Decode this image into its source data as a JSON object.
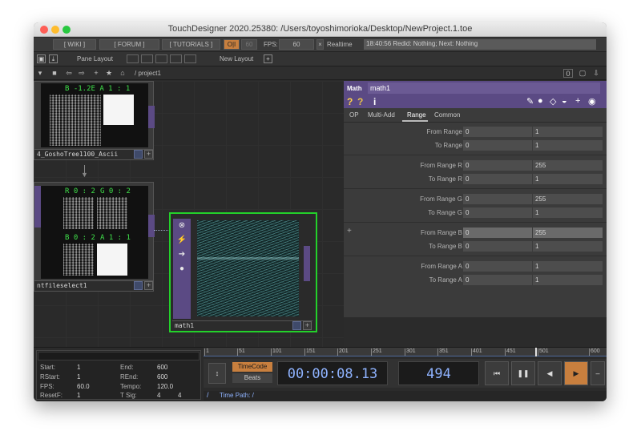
{
  "window": {
    "title": "TouchDesigner 2020.25380: /Users/toyoshimorioka/Desktop/NewProject.1.toe"
  },
  "menubar": {
    "wiki": "[ WIKI ]",
    "forum": "[ FORUM ]",
    "tutorials": "[ TUTORIALS ]",
    "perform_toggle": "O|I",
    "fps_target": "60",
    "fps_label": "FPS:",
    "fps_value": "60",
    "realtime_label": "Realtime",
    "status": "18:40:56 Redid: Nothing; Next: Nothing"
  },
  "panebar": {
    "pane_layout": "Pane Layout",
    "new_layout": "New Layout",
    "plus": "+"
  },
  "pathbar": {
    "path": "/ project1",
    "zero": "0"
  },
  "nodes": {
    "top_name": "4_GoshoTree1100_Ascii",
    "top_overlay": "B -1.2E A 1 : 1",
    "mid_name": "ntfileselect1",
    "mid_r": "R 0 : 2",
    "mid_g": "G 0 : 2",
    "mid_b": "B 0 : 2",
    "mid_a": "A 1 : 1",
    "math_name": "math1"
  },
  "params": {
    "op_type": "Math",
    "op_name": "math1",
    "tabs": [
      "OP",
      "Multi-Add",
      "Range",
      "Common"
    ],
    "active_tab": "Range",
    "rows": [
      {
        "label": "From Range",
        "a": "0",
        "b": "1"
      },
      {
        "label": "To Range",
        "a": "0",
        "b": "1"
      },
      {
        "label": "From Range R",
        "a": "0",
        "b": "255"
      },
      {
        "label": "To Range R",
        "a": "0",
        "b": "1"
      },
      {
        "label": "From Range G",
        "a": "0",
        "b": "255"
      },
      {
        "label": "To Range G",
        "a": "0",
        "b": "1"
      },
      {
        "label": "From Range B",
        "a": "0",
        "b": "255"
      },
      {
        "label": "To Range B",
        "a": "0",
        "b": "1"
      },
      {
        "label": "From Range A",
        "a": "0",
        "b": "1"
      },
      {
        "label": "To Range A",
        "a": "0",
        "b": "1"
      }
    ]
  },
  "timeline": {
    "start_label": "Start:",
    "start": "1",
    "end_label": "End:",
    "end": "600",
    "rstart_label": "RStart:",
    "rstart": "1",
    "rend_label": "REnd:",
    "rend": "600",
    "fps_label": "FPS:",
    "fps": "60.0",
    "tempo_label": "Tempo:",
    "tempo": "120.0",
    "resetf_label": "ResetF:",
    "resetf": "1",
    "tsig_label": "T Sig:",
    "tsig_a": "4",
    "tsig_b": "4",
    "ruler": [
      "1",
      "51",
      "101",
      "151",
      "201",
      "251",
      "301",
      "351",
      "401",
      "451",
      "501",
      "600"
    ],
    "timecode_btn": "TimeCode",
    "beats_btn": "Beats",
    "timecode": "00:00:08.13",
    "frame": "494",
    "time_path": "Time Path: /"
  }
}
